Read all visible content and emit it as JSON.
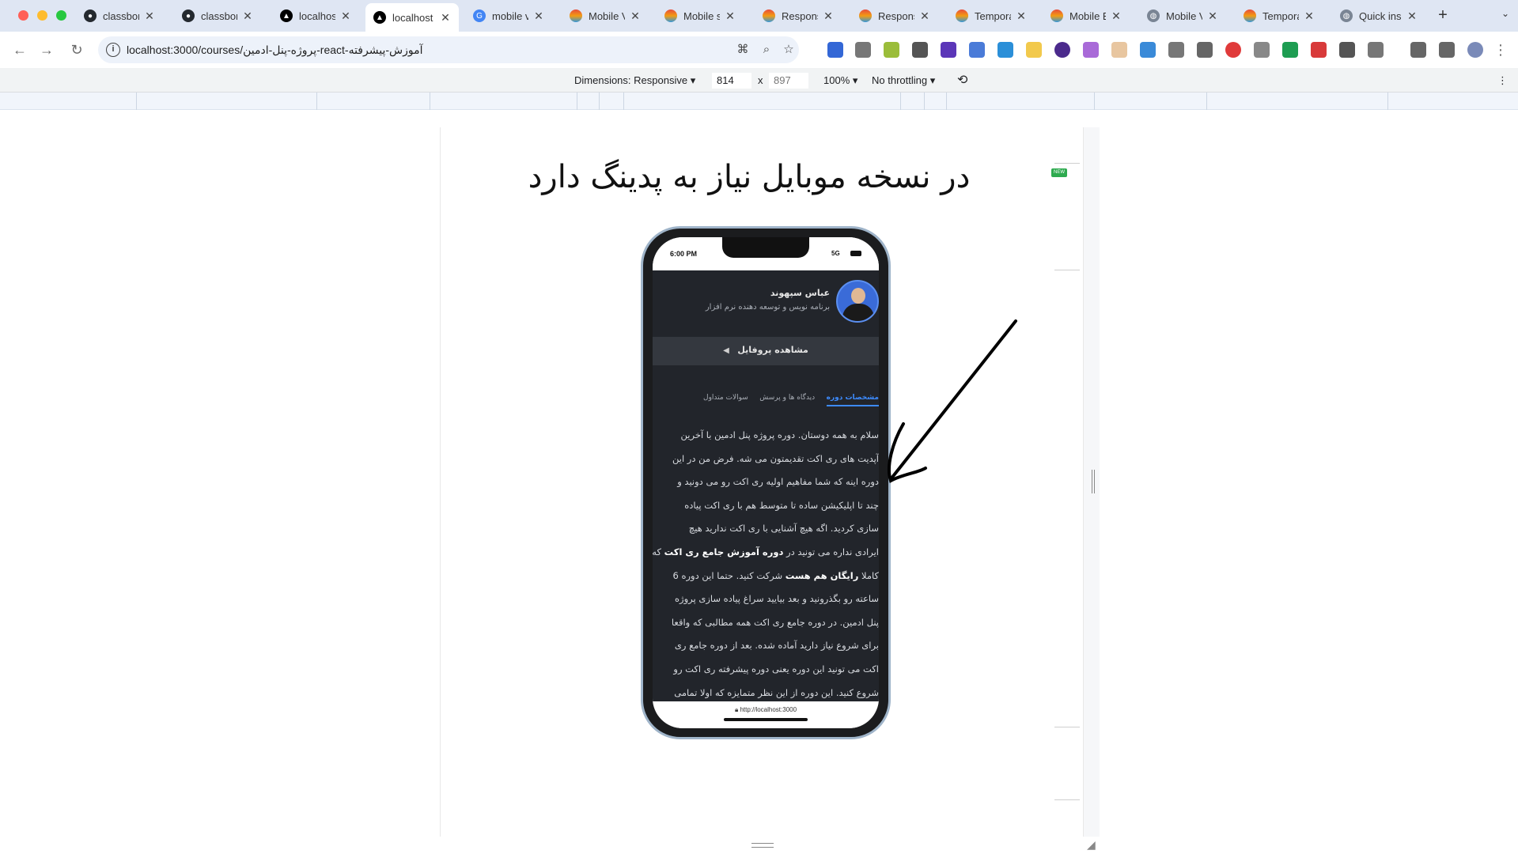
{
  "tabs": [
    {
      "title": "classbon",
      "icon": "github-icon"
    },
    {
      "title": "classbon",
      "icon": "github-icon"
    },
    {
      "title": "localhost",
      "icon": "localhost-icon"
    },
    {
      "title": "localhost",
      "icon": "localhost-icon",
      "active": true
    },
    {
      "title": "mobile vi",
      "icon": "google-icon"
    },
    {
      "title": "Mobile V",
      "icon": "rainbow-icon"
    },
    {
      "title": "Mobile si",
      "icon": "rainbow-icon"
    },
    {
      "title": "Respons",
      "icon": "rainbow-icon"
    },
    {
      "title": "Respons",
      "icon": "rainbow-icon"
    },
    {
      "title": "Tempora",
      "icon": "rainbow-icon"
    },
    {
      "title": "Mobile B",
      "icon": "rainbow-icon"
    },
    {
      "title": "Mobile V",
      "icon": "globe-icon"
    },
    {
      "title": "Tempora",
      "icon": "rainbow-icon"
    },
    {
      "title": "Quick ins",
      "icon": "globe-icon"
    }
  ],
  "address": {
    "url": "localhost:3000/courses/پروژه-پنل-ادمین-react-آموزش-پیشرفته"
  },
  "device": {
    "dimensions_label": "Dimensions: Responsive",
    "width": "814",
    "height": "897",
    "zoom": "100%",
    "throttle": "No throttling",
    "times": "x"
  },
  "page": {
    "heading": "در نسخه موبایل نیاز به پدینگ دارد",
    "badge": "NEW"
  },
  "phone": {
    "time": "6:00 PM",
    "signal": "5G",
    "instructor_name": "عباس سپهوند",
    "instructor_title": "برنامه نویس و توسعه دهنده نرم افزار",
    "profile_button": "مشاهده پروفایل",
    "tabs": [
      "مشخصات دوره",
      "دیدگاه ها و پرسش",
      "سوالات متداول"
    ],
    "paragraph_lines": [
      "سلام به همه دوستان. دوره پروژه پنل ادمین با آخرین",
      "آپدیت های ری اکت تقدیمتون می شه. فرض من در این",
      "دوره اینه که شما مفاهیم اولیه ری اکت رو می دونید و",
      "چند تا اپلیکیشن ساده تا متوسط هم با ری اکت پیاده",
      "سازی کردید. اگه هیچ آشنایی با ری اکت ندارید هیچ",
      "ایرادی نداره می تونید در",
      "دوره آموزش جامع ری اکت",
      "که",
      "کاملا",
      "رایگان هم هست",
      "شرکت کنید. حتما این دوره 6",
      "ساعته رو بگذرونید و بعد بیایید سراغ پیاده سازی پروژه",
      "پنل ادمین. در دوره جامع ری اکت همه مطالبی که واقعا",
      "برای شروع نیاز دارید آماده شده. بعد از دوره جامع ری",
      "اکت می تونید این دوره یعنی دوره پیشرفته ری اکت رو",
      "شروع کنید. این دوره از این نظر متمایزه که اولا تمامی"
    ],
    "url": "http://localhost:3000"
  },
  "colors": {
    "accent": "#3d8bfd",
    "app_bg": "#22252b",
    "badge": "#2eaa4f"
  }
}
